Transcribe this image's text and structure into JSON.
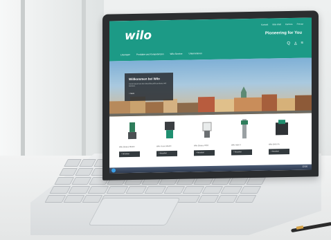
{
  "website": {
    "logo": "wilo",
    "utility_links": [
      "Kontakt",
      "Wilo-Welt",
      "Karriere",
      "Presse"
    ],
    "tagline": "Pioneering for You",
    "tools": {
      "search": "Q",
      "account": "♙",
      "cart": "≡"
    },
    "nav": [
      "Lösungen",
      "Produkte und Kompetenzen",
      "Wilo-Service",
      "Unternehmen"
    ],
    "hero": {
      "title": "Willkommen bei Wilo",
      "subtitle": "Lorem ipsum text line describing Wilo products and services.",
      "link": "> Mehr"
    },
    "products": [
      {
        "name": "Wilo-Stratos MAXO",
        "button": "> Ansehen"
      },
      {
        "name": "Wilo-Yonos MAXO",
        "button": "> Ansehen"
      },
      {
        "name": "Wilo-Stratos PICO",
        "button": "> Ansehen"
      },
      {
        "name": "Wilo-Helix V",
        "button": "> Ansehen"
      },
      {
        "name": "Wilo-EMU FA",
        "button": "> Ansehen"
      }
    ]
  },
  "taskbar": {
    "tray_text": "12:00"
  },
  "colors": {
    "brand": "#1c9a86",
    "dark_button": "#333a3e"
  }
}
